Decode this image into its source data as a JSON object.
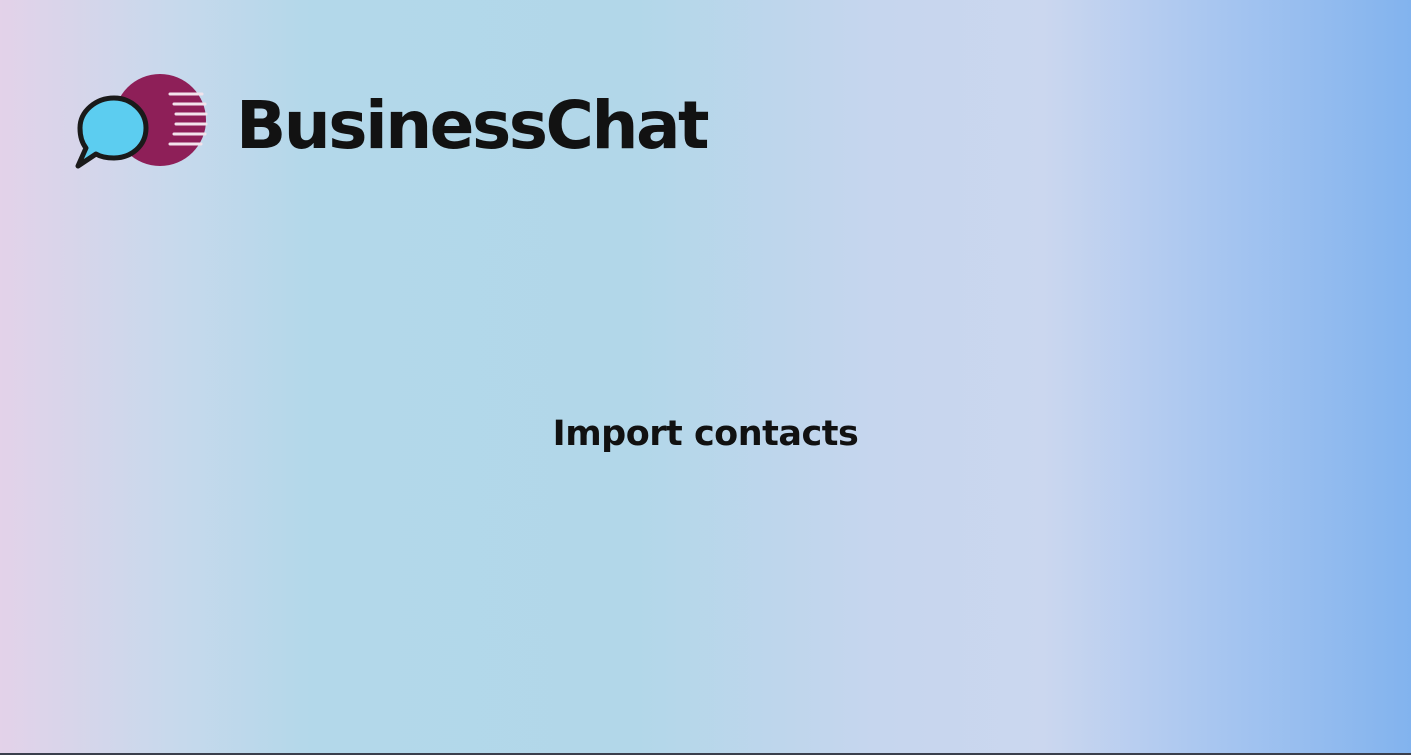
{
  "brand": {
    "name": "BusinessChat",
    "colors": {
      "bubble_front": "#5ccdf0",
      "bubble_back": "#8e1f58",
      "outline": "#1a1a1a"
    }
  },
  "main": {
    "title": "Import contacts"
  },
  "icons": {
    "logo": "chat-bubbles-icon"
  }
}
